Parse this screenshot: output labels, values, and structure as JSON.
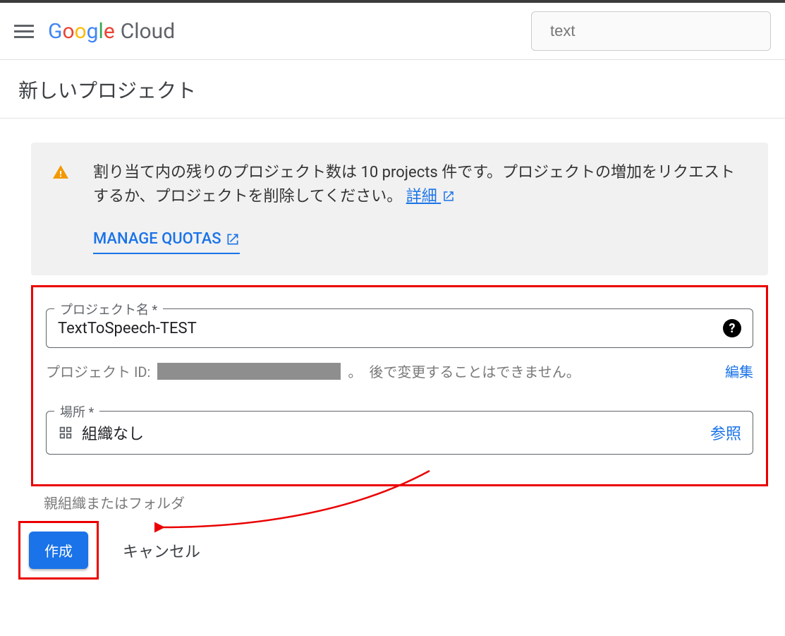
{
  "header": {
    "logo_google": "Google",
    "logo_cloud": "Cloud",
    "search_value": "text"
  },
  "page_title": "新しいプロジェクト",
  "notice": {
    "body": "割り当て内の残りのプロジェクト数は 10 projects 件です。プロジェクトの増加をリクエストするか、プロジェクトを削除してください。",
    "details_label": "詳細",
    "manage_label": "MANAGE QUOTAS"
  },
  "form": {
    "project_name_label": "プロジェクト名 *",
    "project_name_value": "TextToSpeech-TEST",
    "project_id_prefix": "プロジェクト ID:",
    "project_id_suffix_punct": "。",
    "project_id_note": "後で変更することはできません。",
    "edit_label": "編集",
    "location_label": "場所 *",
    "location_value": "組織なし",
    "browse_label": "参照",
    "location_helper": "親組織またはフォルダ"
  },
  "buttons": {
    "create": "作成",
    "cancel": "キャンセル"
  }
}
